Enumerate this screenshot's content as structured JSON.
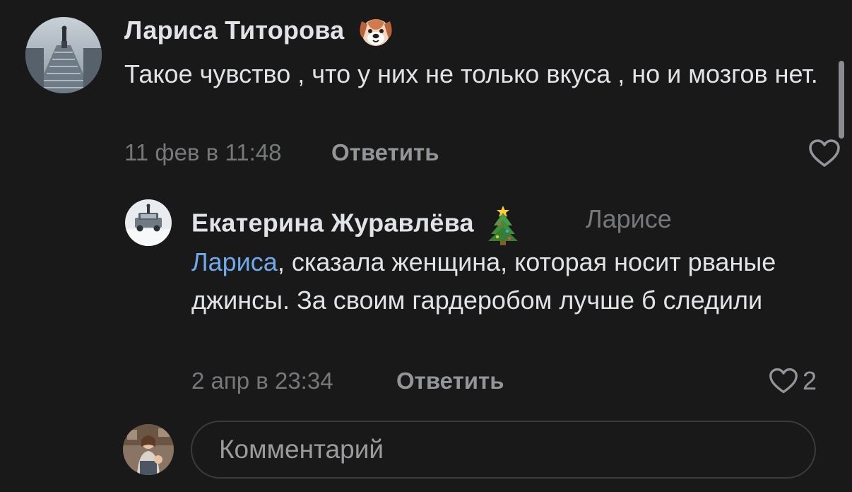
{
  "comments": [
    {
      "author": "Лариса Титорова",
      "author_emoji_icon": "dog-face-icon",
      "text": "Такое чувство , что у них не только вкуса , но и мозгов нет.",
      "date": "11 фев в 11:48",
      "reply_label": "Ответить",
      "likes": ""
    }
  ],
  "replies": [
    {
      "author": "Екатерина Журавлёва",
      "author_emoji_icon": "christmas-tree-icon",
      "reply_to": "Ларисе",
      "mention": "Лариса",
      "text": ", сказала женщина, которая носит рваные джинсы. За своим гардеробом лучше б следили",
      "date": "2 апр в 23:34",
      "reply_label": "Ответить",
      "likes": "2"
    }
  ],
  "composer": {
    "placeholder": "Комментарий"
  },
  "colors": {
    "background": "#19191a",
    "text": "#e1e3e6",
    "secondary": "#76787a",
    "link": "#71aaeb",
    "action": "#939599"
  }
}
